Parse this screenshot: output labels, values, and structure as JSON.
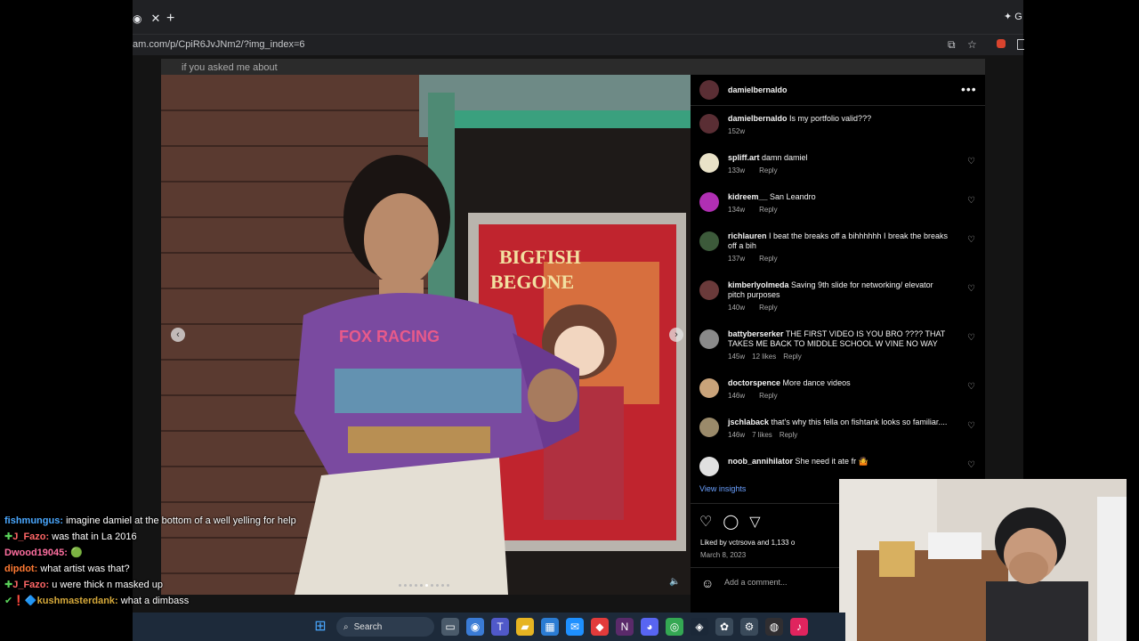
{
  "browser": {
    "tab_close": "✕",
    "new_tab": "+",
    "gemini": "✦ G",
    "url": "am.com/p/CpiR6JvJNm2/?img_index=6",
    "icons": {
      "cast": "⧉",
      "star": "☆"
    }
  },
  "media": {
    "top_caption": "if you asked me about",
    "poster_text": [
      "BIGFISH",
      "BEGONE"
    ],
    "sweater_text": "FOX RACING",
    "prev_arrow": "‹",
    "next_arrow": "›",
    "mute_icon": "🔈",
    "slide_count": 10,
    "active_slide": 6
  },
  "post": {
    "username": "damielbernaldo",
    "more": "•••",
    "comments": [
      {
        "user": "damielbernaldo",
        "text": "Is my portfolio valid???",
        "time": "152w",
        "likes": "",
        "reply": "",
        "avatar_color": "#5a2e34",
        "heart": ""
      },
      {
        "user": "spliff.art",
        "text": "damn damiel",
        "time": "133w",
        "likes": "",
        "reply": "Reply",
        "avatar_color": "#e9e2c8",
        "heart": "♡"
      },
      {
        "user": "kidreem__",
        "text": "San Leandro",
        "time": "134w",
        "likes": "",
        "reply": "Reply",
        "avatar_color": "#b02fb3",
        "heart": "♡"
      },
      {
        "user": "richlauren",
        "text": "I beat the breaks off a bihhhhhh I break the breaks off a bih",
        "time": "137w",
        "likes": "",
        "reply": "Reply",
        "avatar_color": "#3c5a3a",
        "heart": "♡"
      },
      {
        "user": "kimberlyolmeda",
        "text": "Saving 9th slide for networking/ elevator pitch purposes",
        "time": "140w",
        "likes": "",
        "reply": "Reply",
        "avatar_color": "#6a3a3a",
        "heart": "♡"
      },
      {
        "user": "battyberserker",
        "text": "THE FIRST VIDEO IS YOU BRO ???? THAT TAKES ME BACK TO MIDDLE SCHOOL W VINE NO WAY",
        "time": "145w",
        "likes": "12 likes",
        "reply": "Reply",
        "avatar_color": "#8a8a8a",
        "heart": "♡"
      },
      {
        "user": "doctorspence",
        "text": "More dance videos",
        "time": "146w",
        "likes": "",
        "reply": "Reply",
        "avatar_color": "#c9a37a",
        "heart": "♡"
      },
      {
        "user": "jschlaback",
        "text": "that's why this fella on fishtank looks so familiar....",
        "time": "146w",
        "likes": "7 likes",
        "reply": "Reply",
        "avatar_color": "#9a8a6a",
        "heart": "♡"
      },
      {
        "user": "noob_annihilator",
        "text": "She need it ate fr 🤷",
        "time": "",
        "likes": "",
        "reply": "",
        "avatar_color": "#e0e0e0",
        "heart": "♡"
      }
    ],
    "view_insights": "View insights",
    "actions": {
      "like": "♡",
      "comment": "◯",
      "share": "▽"
    },
    "liked_by": "Liked by vctrsova and 1,133 o",
    "date": "March 8, 2023",
    "emoji": "☺",
    "comment_placeholder": "Add a comment..."
  },
  "chat": [
    {
      "badge": "",
      "user": "fishmungus:",
      "color": "#4aa8ff",
      "message": "imagine damiel at the bottom of a well yelling for help"
    },
    {
      "badge": "✚",
      "user": "J_Fazo:",
      "color": "#ff6666",
      "message": "was that in La 2016"
    },
    {
      "badge": "",
      "user": "Dwood19045:",
      "color": "#ff6fa0",
      "message": "🟢"
    },
    {
      "badge": "",
      "user": "dipdot:",
      "color": "#ff7a33",
      "message": "what artist was that?"
    },
    {
      "badge": "✚",
      "user": "J_Fazo:",
      "color": "#ff6666",
      "message": "u were thick n masked up"
    },
    {
      "badge": "✔❗🔷",
      "user": "kushmasterdank:",
      "color": "#d6a93a",
      "message": "what a dimbass"
    }
  ],
  "taskbar": {
    "search_label": "Search",
    "search_icon": "⌕",
    "start_icon": "⊞",
    "apps": [
      {
        "name": "task-view-icon",
        "glyph": "▭",
        "color": "#4a5a6a"
      },
      {
        "name": "copilot-icon",
        "glyph": "◉",
        "color": "#3a7bd5"
      },
      {
        "name": "teams-icon",
        "glyph": "T",
        "color": "#5059c9"
      },
      {
        "name": "file-explorer-icon",
        "glyph": "▰",
        "color": "#e6b422"
      },
      {
        "name": "store-icon",
        "glyph": "▦",
        "color": "#2b7cd3"
      },
      {
        "name": "mail-icon",
        "glyph": "✉",
        "color": "#1e90ff"
      },
      {
        "name": "red-app-icon",
        "glyph": "◆",
        "color": "#e23b3b"
      },
      {
        "name": "next-app-icon",
        "glyph": "N",
        "color": "#5a2a6a"
      },
      {
        "name": "discord-icon",
        "glyph": "◕",
        "color": "#5865f2"
      },
      {
        "name": "chrome-icon",
        "glyph": "◎",
        "color": "#34a853"
      },
      {
        "name": "steam-icon",
        "glyph": "◈",
        "color": "#1b2838"
      },
      {
        "name": "app-icon-1",
        "glyph": "✿",
        "color": "#3a4a5a"
      },
      {
        "name": "settings-icon",
        "glyph": "⚙",
        "color": "#3a4a5a"
      },
      {
        "name": "obs-icon",
        "glyph": "◍",
        "color": "#302e31"
      },
      {
        "name": "music-icon",
        "glyph": "♪",
        "color": "#e0245e"
      }
    ]
  }
}
